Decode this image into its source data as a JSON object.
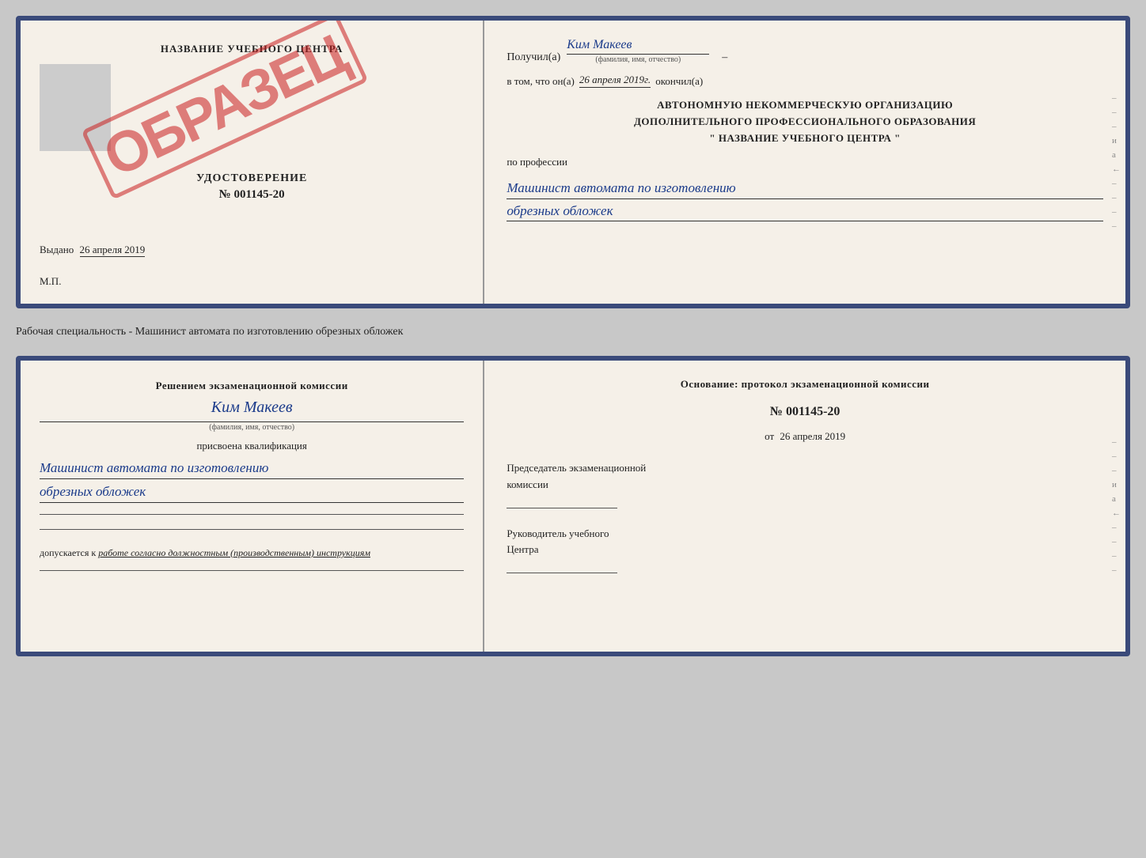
{
  "doc1": {
    "left": {
      "title": "НАЗВАНИЕ УЧЕБНОГО ЦЕНТРА",
      "photo_placeholder": "",
      "stamp": "ОБРАЗЕЦ",
      "udostoverenie_label": "УДОСТОВЕРЕНИЕ",
      "udostoverenie_num": "№ 001145-20",
      "vydano_label": "Выдано",
      "vydano_date": "26 апреля 2019",
      "mp_label": "М.П."
    },
    "right": {
      "poluchil_label": "Получил(а)",
      "poluchil_name": "Ким Макеев",
      "fio_caption": "(фамилия, имя, отчество)",
      "vtom_label": "в том, что он(а)",
      "vtom_date": "26 апреля 2019г.",
      "okonchil_label": "окончил(а)",
      "org_line1": "АВТОНОМНУЮ НЕКОММЕРЧЕСКУЮ ОРГАНИЗАЦИЮ",
      "org_line2": "ДОПОЛНИТЕЛЬНОГО ПРОФЕССИОНАЛЬНОГО ОБРАЗОВАНИЯ",
      "org_line3": "\"   НАЗВАНИЕ УЧЕБНОГО ЦЕНТРА   \"",
      "po_professii_label": "по профессии",
      "professiya_line1": "Машинист автомата по изготовлению",
      "professiya_line2": "обрезных обложек"
    }
  },
  "separator": {
    "text": "Рабочая специальность - Машинист автомата по изготовлению обрезных обложек"
  },
  "doc2": {
    "left": {
      "resheniyem_label": "Решением экзаменационной комиссии",
      "kim_makeev": "Ким Макеев",
      "fio_caption": "(фамилия, имя, отчество)",
      "prisvoena_label": "присвоена квалификация",
      "kvalifikaciya_line1": "Машинист автомата по изготовлению",
      "kvalifikaciya_line2": "обрезных обложек",
      "dopuskaetsya_prefix": "допускается к",
      "dopuskaetsya_italic": "работе согласно должностным (производственным) инструкциям"
    },
    "right": {
      "osnovanie_label": "Основание: протокол экзаменационной комиссии",
      "protocol_num": "№  001145-20",
      "ot_label": "от",
      "ot_date": "26 апреля 2019",
      "predsedatel_line1": "Председатель экзаменационной",
      "predsedatel_line2": "комиссии",
      "rukovoditel_line1": "Руководитель учебного",
      "rukovoditel_line2": "Центра"
    }
  },
  "side_chars": [
    "и",
    "а",
    "←",
    "–",
    "–",
    "–",
    "–"
  ]
}
